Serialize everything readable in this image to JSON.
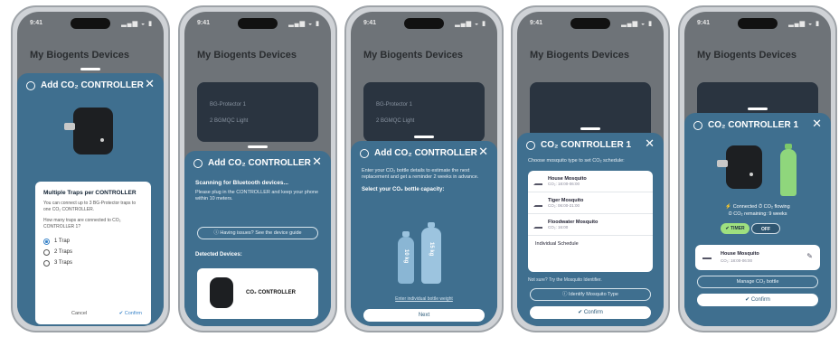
{
  "phones": [
    {
      "time": "9:41",
      "indicators": "▂▄▆ ◒ ▮",
      "background_title": "My Biogents Devices",
      "sheet": {
        "title": "Add CO₂ CONTROLLER",
        "dialog_title": "Multiple Traps per CONTROLLER",
        "dialog_text": "You can connect up to 3 BG-Protector traps to one CO₂ CONTROLLER.",
        "dialog_question": "How many traps are connected to CO₂ CONTROLLER 1?",
        "options": [
          "1 Trap",
          "2 Traps",
          "3 Traps"
        ],
        "selected_option": 0,
        "cancel_label": "Cancel",
        "confirm_label": "✔ Confirm"
      }
    },
    {
      "time": "9:41",
      "indicators": "▂▄▆ ◒ ▮",
      "background_title": "My Biogents Devices",
      "background_rows": [
        "BG-Protector 1",
        "2 BGMQC Light"
      ],
      "sheet": {
        "title": "Add CO₂ CONTROLLER",
        "scanning": "Scanning for Bluetooth devices...",
        "scanning_text": "Please plug in the CONTROLLER and keep your phone within 10 meters.",
        "help_button": "ⓘ Having issues? See the device guide",
        "detected_label": "Detected Devices:",
        "device_name": "CO₂ CONTROLLER"
      }
    },
    {
      "time": "9:41",
      "indicators": "▂▄▆ ◒ ▮",
      "background_title": "My Biogents Devices",
      "background_rows": [
        "BG-Protector 1",
        "2 BGMQC Light"
      ],
      "sheet": {
        "title": "Add CO₂ CONTROLLER",
        "intro": "Enter your CO₂ bottle details to estimate the next replacement and get a reminder 2 weeks in advance.",
        "capacity_label": "Select your CO₂ bottle capacity:",
        "bottle_small": "10 kg",
        "bottle_large": "15 kg",
        "weight_link": "Enter individual bottle weight",
        "next_label": "Next"
      }
    },
    {
      "time": "9:41",
      "indicators": "▂▄▆ ◒ ▮",
      "background_title": "My Biogents Devices",
      "sheet": {
        "title": "CO₂ CONTROLLER 1",
        "intro": "Choose mosquito type to set CO₂ schedule:",
        "schedules": [
          {
            "name": "House Mosquito",
            "sub": "CO₂: 18:00-06:00"
          },
          {
            "name": "Tiger Mosquito",
            "sub": "CO₂: 06:00-21:00"
          },
          {
            "name": "Floodwater Mosquito",
            "sub": "CO₂: 16:00"
          }
        ],
        "individual": "Individual Schedule",
        "not_sure": "Not sure? Try the Mosquito Identifier.",
        "identify_button": "ⓘ Identify Mosquito Type",
        "confirm_label": "✔ Confirm"
      }
    },
    {
      "time": "9:41",
      "indicators": "▂▄▆ ◒ ▮",
      "background_title": "My Biogents Devices",
      "sheet": {
        "title": "CO₂ CONTROLLER 1",
        "status_lines": [
          "⚡ Connected  ⏱ CO₂ flowing",
          "⏲ CO₂ remaining: 9 weeks"
        ],
        "toggle_on": "✔ TIMER",
        "toggle_off": "OFF",
        "schedule_name": "House Mosquito",
        "schedule_sub": "CO₂: 18:00-06:00",
        "manage_button": "Manage CO₂ bottle",
        "confirm_label": "✔ Confirm"
      }
    }
  ]
}
